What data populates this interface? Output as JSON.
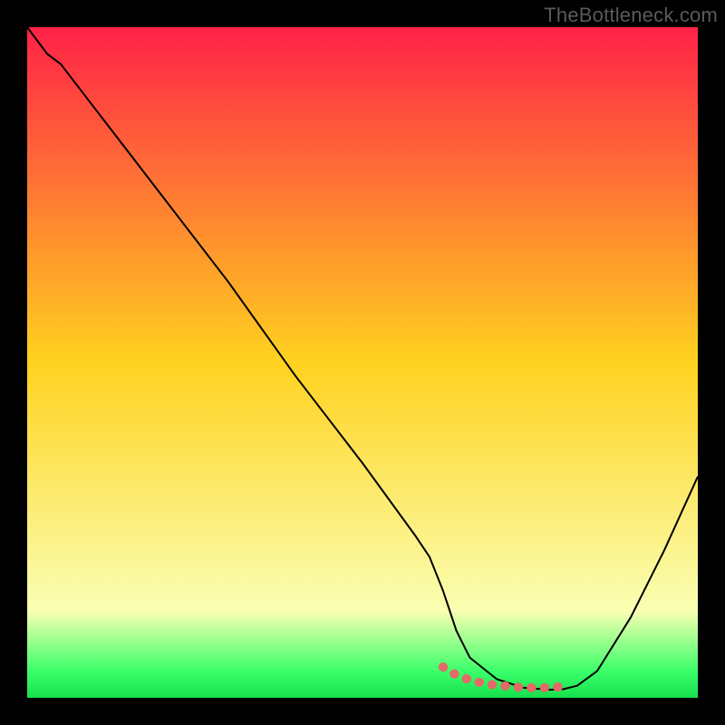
{
  "watermark": "TheBottleneck.com",
  "chart_data": {
    "type": "line",
    "title": "",
    "xlabel": "",
    "ylabel": "",
    "xlim": [
      0,
      100
    ],
    "ylim": [
      0,
      100
    ],
    "grid": false,
    "legend": false,
    "gradient_stops": [
      {
        "offset": 0,
        "color": "#ff2247"
      },
      {
        "offset": 50,
        "color": "#ffd21f"
      },
      {
        "offset": 87,
        "color": "#faffb3"
      },
      {
        "offset": 96,
        "color": "#3cff6a"
      },
      {
        "offset": 100,
        "color": "#16e04e"
      }
    ],
    "series": [
      {
        "name": "bottleneck-curve",
        "color": "#000000",
        "width": 2,
        "x": [
          0,
          3,
          5,
          10,
          20,
          30,
          40,
          50,
          58,
          60,
          62,
          64,
          66,
          70,
          74,
          78,
          80,
          82,
          85,
          90,
          95,
          100
        ],
        "y": [
          100,
          96,
          94.5,
          88,
          75,
          62,
          48,
          35,
          24,
          21,
          16,
          10,
          6,
          2.8,
          1.5,
          1.2,
          1.3,
          1.8,
          4,
          12,
          22,
          33
        ]
      },
      {
        "name": "optimal-range-marker",
        "color": "#e36a66",
        "width": 10,
        "linecap": "round",
        "x": [
          62,
          63,
          64,
          65,
          67,
          69,
          70,
          72,
          73,
          75,
          77,
          79,
          80,
          81
        ],
        "y": [
          4.6,
          4.0,
          3.4,
          3.0,
          2.4,
          2.0,
          1.9,
          1.7,
          1.6,
          1.5,
          1.5,
          1.6,
          1.7,
          1.9
        ]
      }
    ],
    "annotations": []
  }
}
